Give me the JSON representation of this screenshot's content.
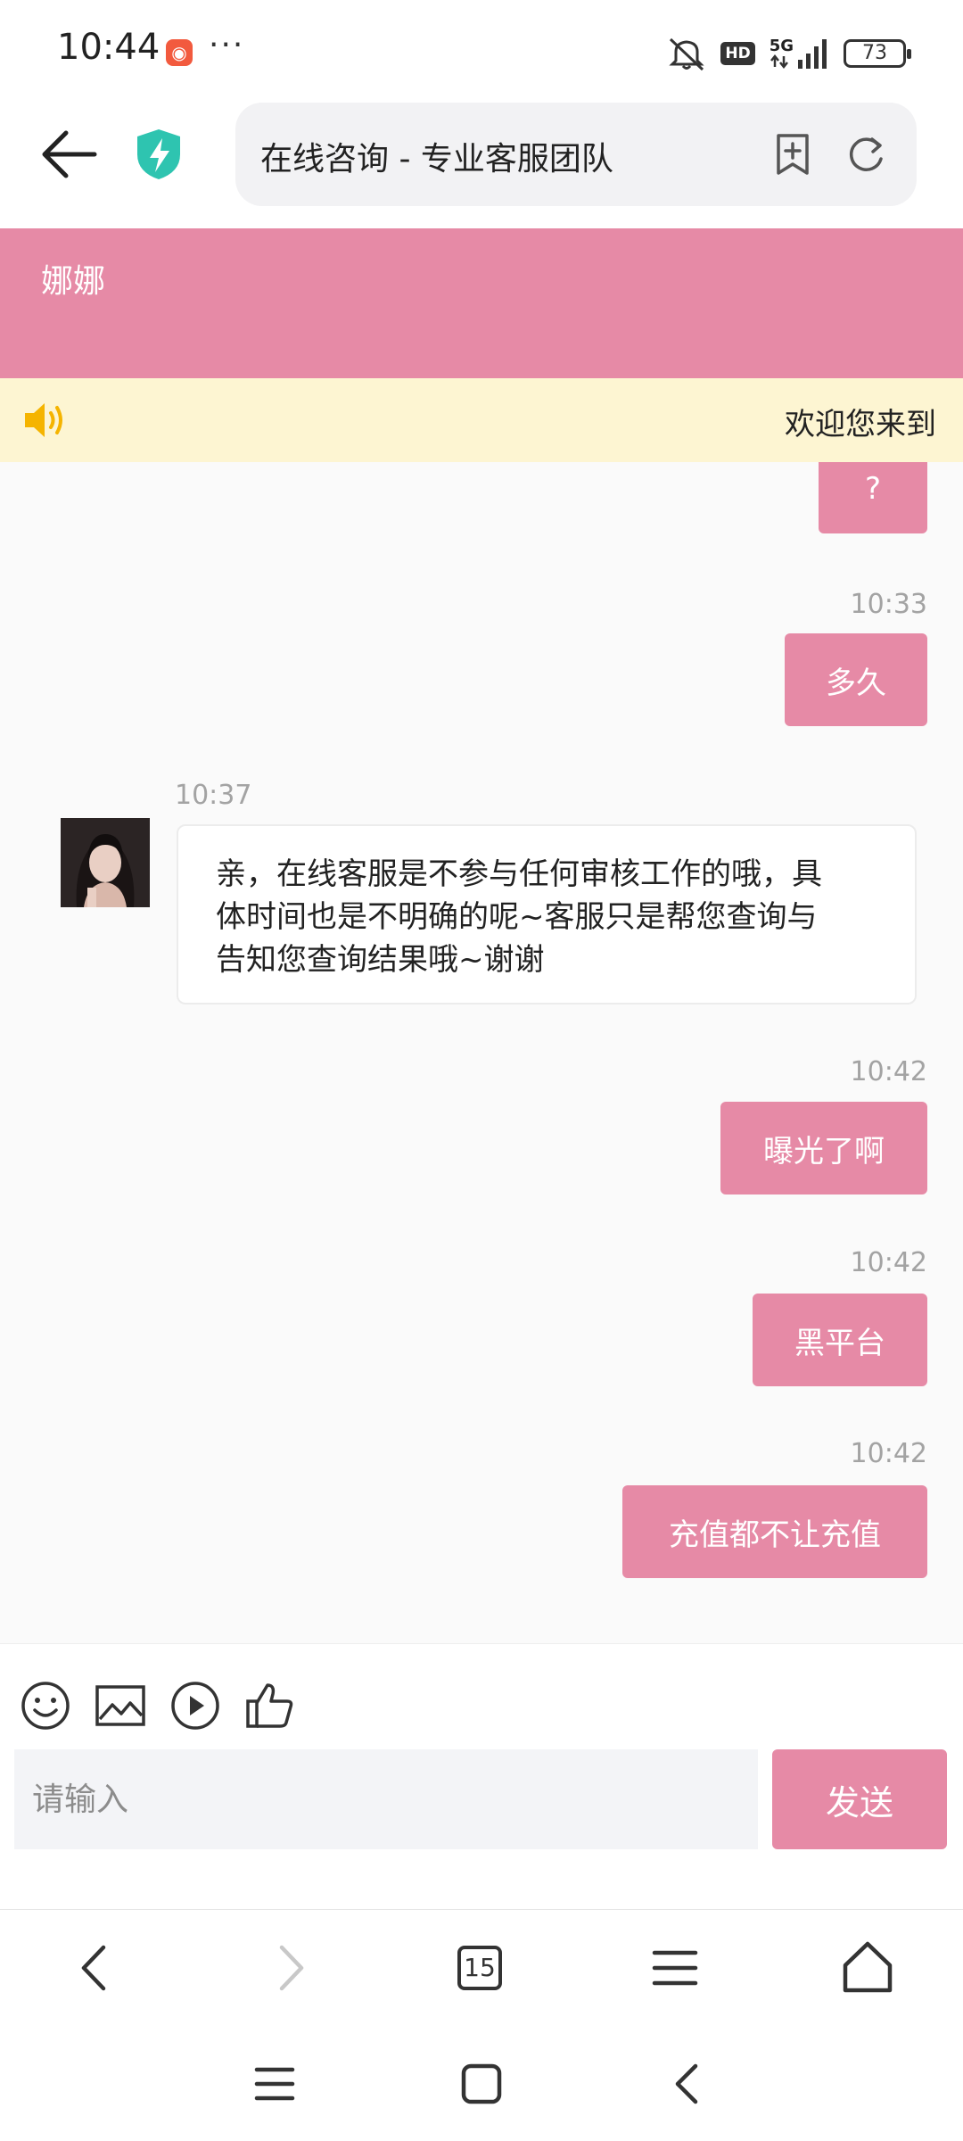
{
  "status_bar": {
    "time": "10:44",
    "notification_dots": "···",
    "hd": "HD",
    "network": "5G",
    "battery": "73"
  },
  "browser": {
    "page_title": "在线咨询 - 专业客服团队"
  },
  "chat_header": {
    "agent_name": "娜娜"
  },
  "notice": {
    "text": "欢迎您来到"
  },
  "messages": [
    {
      "direction": "outgoing",
      "text": "?"
    },
    {
      "direction": "outgoing",
      "time": "10:33",
      "text": "多久"
    },
    {
      "direction": "incoming",
      "time": "10:37",
      "lines": [
        "亲，在线客服是不参与任何审核工作的哦，具",
        "体时间也是不明确的呢~客服只是帮您查询与",
        "告知您查询结果哦~谢谢"
      ]
    },
    {
      "direction": "outgoing",
      "time": "10:42",
      "text": "曝光了啊"
    },
    {
      "direction": "outgoing",
      "time": "10:42",
      "text": "黑平台"
    },
    {
      "direction": "outgoing",
      "time": "10:42",
      "text": "充值都不让充值"
    }
  ],
  "composer": {
    "placeholder": "请输入",
    "send_label": "发送"
  },
  "browser_nav": {
    "tab_count": "15"
  },
  "colors": {
    "accent_pink": "#e68aa6",
    "notice_bg": "#fdf5d2",
    "shield_teal": "#2ec4b0"
  }
}
